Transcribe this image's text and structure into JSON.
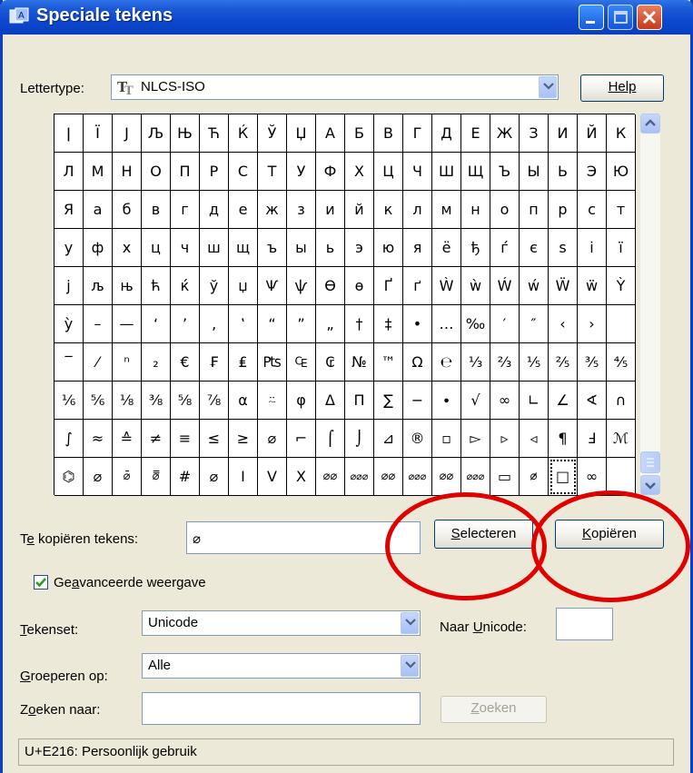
{
  "window": {
    "title": "Speciale tekens",
    "controls": [
      "minimize-icon",
      "maximize-icon",
      "close-icon"
    ]
  },
  "font_row": {
    "label": "Lettertype:",
    "value": "NLCS-ISO",
    "font_icon": "TrueType-font-icon",
    "help_label": "Help"
  },
  "grid": {
    "selected_index": 197,
    "rows": [
      [
        "ǀ",
        "Ï",
        "J",
        "Љ",
        "Њ",
        "Ћ",
        "Ќ",
        "Ў",
        "Џ",
        "А",
        "Б",
        "В",
        "Г",
        "Д",
        "Е",
        "Ж",
        "З",
        "И",
        "Й",
        "К"
      ],
      [
        "Л",
        "М",
        "Н",
        "О",
        "П",
        "Р",
        "С",
        "Т",
        "У",
        "Ф",
        "Х",
        "Ц",
        "Ч",
        "Ш",
        "Щ",
        "Ъ",
        "Ы",
        "Ь",
        "Э",
        "Ю"
      ],
      [
        "Я",
        "а",
        "б",
        "в",
        "г",
        "д",
        "е",
        "ж",
        "з",
        "и",
        "й",
        "к",
        "л",
        "м",
        "н",
        "о",
        "п",
        "р",
        "с",
        "т"
      ],
      [
        "у",
        "ф",
        "х",
        "ц",
        "ч",
        "ш",
        "щ",
        "ъ",
        "ы",
        "ь",
        "э",
        "ю",
        "я",
        "ё",
        "ђ",
        "ѓ",
        "є",
        "ѕ",
        "і",
        "ї"
      ],
      [
        "ј",
        "љ",
        "њ",
        "ћ",
        "ќ",
        "ў",
        "џ",
        "Ѱ",
        "ѱ",
        "Ѳ",
        "ѳ",
        "Ґ",
        "ґ",
        "Ẁ",
        "ẁ",
        "Ẃ",
        "ẃ",
        "Ẅ",
        "ẅ",
        "Ỳ"
      ],
      [
        "ỳ",
        "–",
        "—",
        "‘",
        "’",
        "‚",
        "‛",
        "“",
        "”",
        "„",
        "†",
        "‡",
        "•",
        "…",
        "‰",
        "′",
        "″",
        "‹",
        "›",
        ""
      ],
      [
        "‾",
        "⁄",
        "ⁿ",
        "₂",
        "€",
        "₣",
        "₤",
        "₧",
        "₠",
        "₢",
        "№",
        "™",
        "Ω",
        "℮",
        "⅓",
        "⅔",
        "⅕",
        "⅖",
        "⅗",
        "⅘"
      ],
      [
        "⅙",
        "⅚",
        "⅛",
        "⅜",
        "⅝",
        "⅞",
        "⍺",
        "⍨",
        "φ",
        "Δ",
        "Π",
        "∑",
        "−",
        "∙",
        "√",
        "∞",
        "∟",
        "∠",
        "∢",
        "∩"
      ],
      [
        "∫",
        "≈",
        "≙",
        "≠",
        "≡",
        "≤",
        "≥",
        "⌀",
        "⌐",
        "⌠",
        "⌡",
        "⊿",
        "®",
        "▫",
        "▻",
        "▹",
        "◃",
        "¶",
        "Ⅎ",
        "ℳ"
      ],
      [
        "⌬",
        "⌀",
        "⌀̄",
        "⌀̿",
        "#",
        "⌀",
        "Ι",
        "Ⅴ",
        "Ⅹ",
        "⌀⌀",
        "⌀⌀⌀",
        "⌀⌀",
        "⌀⌀⌀",
        "⌀⌀",
        "⌀⌀⌀",
        "▭",
        "⌀̷",
        "□",
        "∞",
        ""
      ]
    ]
  },
  "copy_row": {
    "label_pre": "T",
    "label_u": "e",
    "label_post": " kopiëren tekens:",
    "value": "⌀",
    "select_pre": "",
    "select_u": "S",
    "select_post": "electeren",
    "copy_pre": "",
    "copy_u": "K",
    "copy_post": "opiëren"
  },
  "advanced": {
    "checked": true,
    "label_pre": "Ge",
    "label_u": "a",
    "label_post": "vanceerde weergave"
  },
  "charset": {
    "label_pre": "",
    "label_u": "T",
    "label_post": "ekenset:",
    "value": "Unicode"
  },
  "unicode_goto": {
    "label_pre": "Naar ",
    "label_u": "U",
    "label_post": "nicode:",
    "value": ""
  },
  "group_by": {
    "label_pre": "",
    "label_u": "G",
    "label_post": "roeperen op:",
    "value": "Alle"
  },
  "search": {
    "label_pre": "Z",
    "label_u": "o",
    "label_post": "eken naar:",
    "value": "",
    "button_pre": "",
    "button_u": "Z",
    "button_post": "oeken"
  },
  "status": {
    "text": "U+E216: Persoonlijk gebruik"
  },
  "annotation_color": "#e00000"
}
